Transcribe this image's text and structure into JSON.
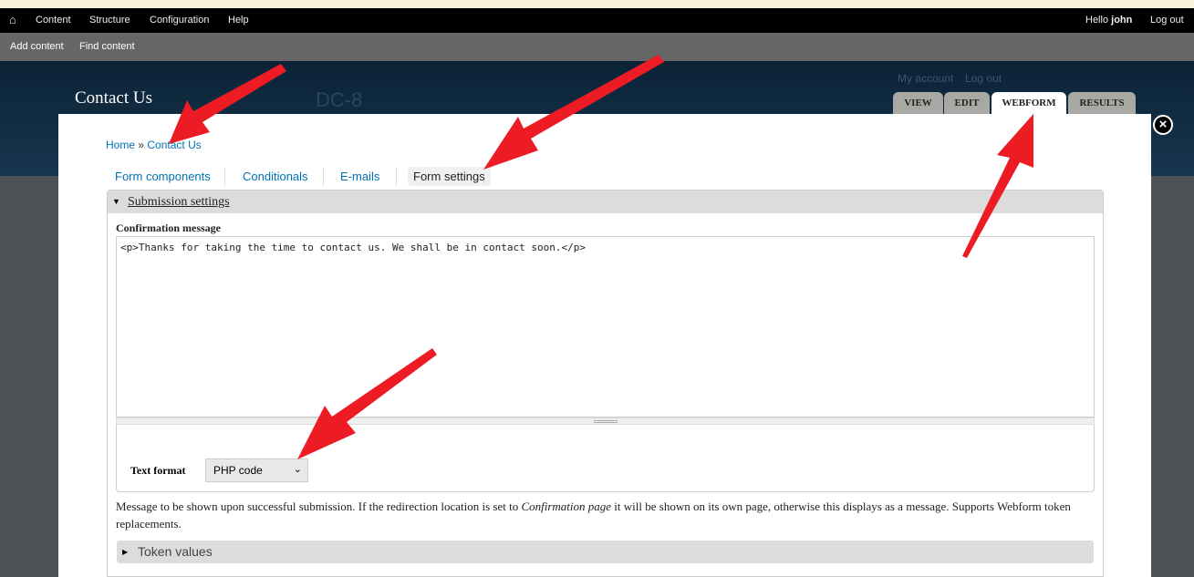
{
  "toolbar": {
    "items": [
      "Content",
      "Structure",
      "Configuration",
      "Help"
    ],
    "greeting": "Hello",
    "user": "john",
    "logout": "Log out"
  },
  "shortcuts": [
    "Add content",
    "Find content"
  ],
  "header": {
    "page_title": "Contact Us",
    "site_name": "DC-8",
    "secondary": [
      "My account",
      "Log out"
    ]
  },
  "primary_tabs": [
    {
      "label": "VIEW"
    },
    {
      "label": "EDIT"
    },
    {
      "label": "WEBFORM",
      "active": true
    },
    {
      "label": "RESULTS"
    }
  ],
  "breadcrumb": {
    "home": "Home",
    "sep": "»",
    "current": "Contact Us"
  },
  "secondary_tabs": [
    {
      "label": "Form components"
    },
    {
      "label": "Conditionals"
    },
    {
      "label": "E-mails"
    },
    {
      "label": "Form settings",
      "active": true
    }
  ],
  "fieldset": {
    "legend": "Submission settings"
  },
  "confirmation": {
    "label": "Confirmation message",
    "value": "<p>Thanks for taking the time to contact us. We shall be in contact soon.</p>"
  },
  "text_format": {
    "label": "Text format",
    "selected": "PHP code"
  },
  "description": {
    "before": "Message to be shown upon successful submission. If the redirection location is set to ",
    "em": "Confirmation page",
    "after": " it will be shown on its own page, otherwise this displays as a message. Supports Webform token replacements."
  },
  "tokens": {
    "label": "Token values"
  },
  "colors": {
    "link": "#0071b3",
    "annotation_arrow": "#ed1c24"
  }
}
